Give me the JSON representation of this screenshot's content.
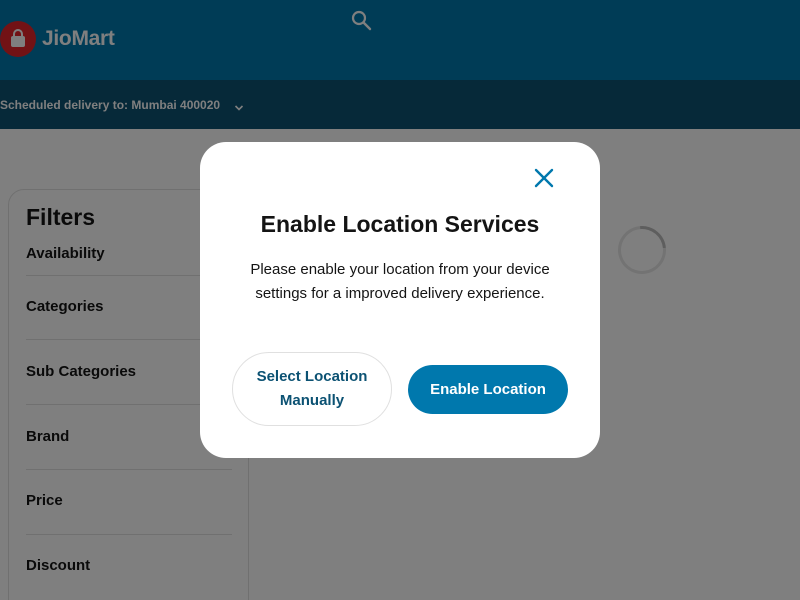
{
  "header": {
    "brand": "JioMart",
    "logo_icon": "shopping-bag-icon",
    "search_icon": "search-icon"
  },
  "delivery": {
    "label": "Scheduled delivery to: Mumbai 400020",
    "chevron_icon": "chevron-down-icon"
  },
  "filters": {
    "title": "Filters",
    "items": [
      "Availability",
      "Categories",
      "Sub Categories",
      "Brand",
      "Price",
      "Discount"
    ]
  },
  "modal": {
    "title": "Enable Location Services",
    "message": "Please enable your location from your device settings for a improved delivery experience.",
    "manual_button": "Select Location Manually",
    "enable_button": "Enable Location",
    "close_icon": "close-icon"
  },
  "colors": {
    "header_bg": "#0078ad",
    "delivery_bar_bg": "#0c5273",
    "logo_red": "#e5252a",
    "primary_button": "#0078ad",
    "overlay": "rgba(0,0,0,0.5)"
  }
}
